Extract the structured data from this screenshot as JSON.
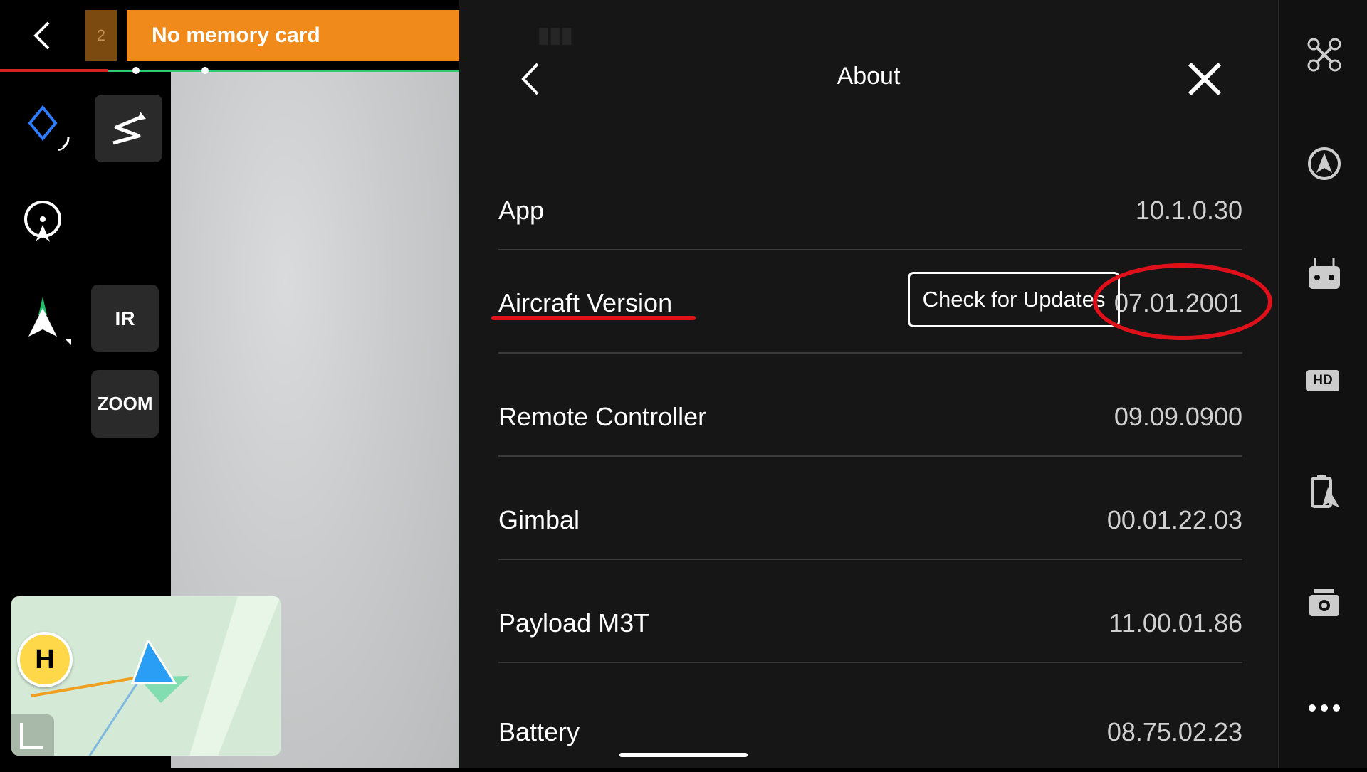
{
  "status_bar": {
    "queue_count": "2",
    "memory_warning": "No memory card"
  },
  "left_tools": {
    "ir_label": "IR",
    "zoom_label": "ZOOM"
  },
  "minimap": {
    "home_label": "H"
  },
  "about": {
    "title": "About",
    "rows": [
      {
        "label": "App",
        "value": "10.1.0.30"
      },
      {
        "label": "Aircraft Version",
        "value": "07.01.2001"
      },
      {
        "label": "Remote Controller",
        "value": "09.09.0900"
      },
      {
        "label": "Gimbal",
        "value": "00.01.22.03"
      },
      {
        "label": "Payload M3T",
        "value": "11.00.01.86"
      },
      {
        "label": "Battery",
        "value": "08.75.02.23"
      }
    ],
    "check_updates_label": "Check for Updates"
  },
  "right_bar": {
    "hd_label": "HD"
  },
  "colors": {
    "banner": "#ef8a1b",
    "highlight": "#e0101a",
    "progress_green": "#2ecc71",
    "progress_red": "#d62020"
  }
}
